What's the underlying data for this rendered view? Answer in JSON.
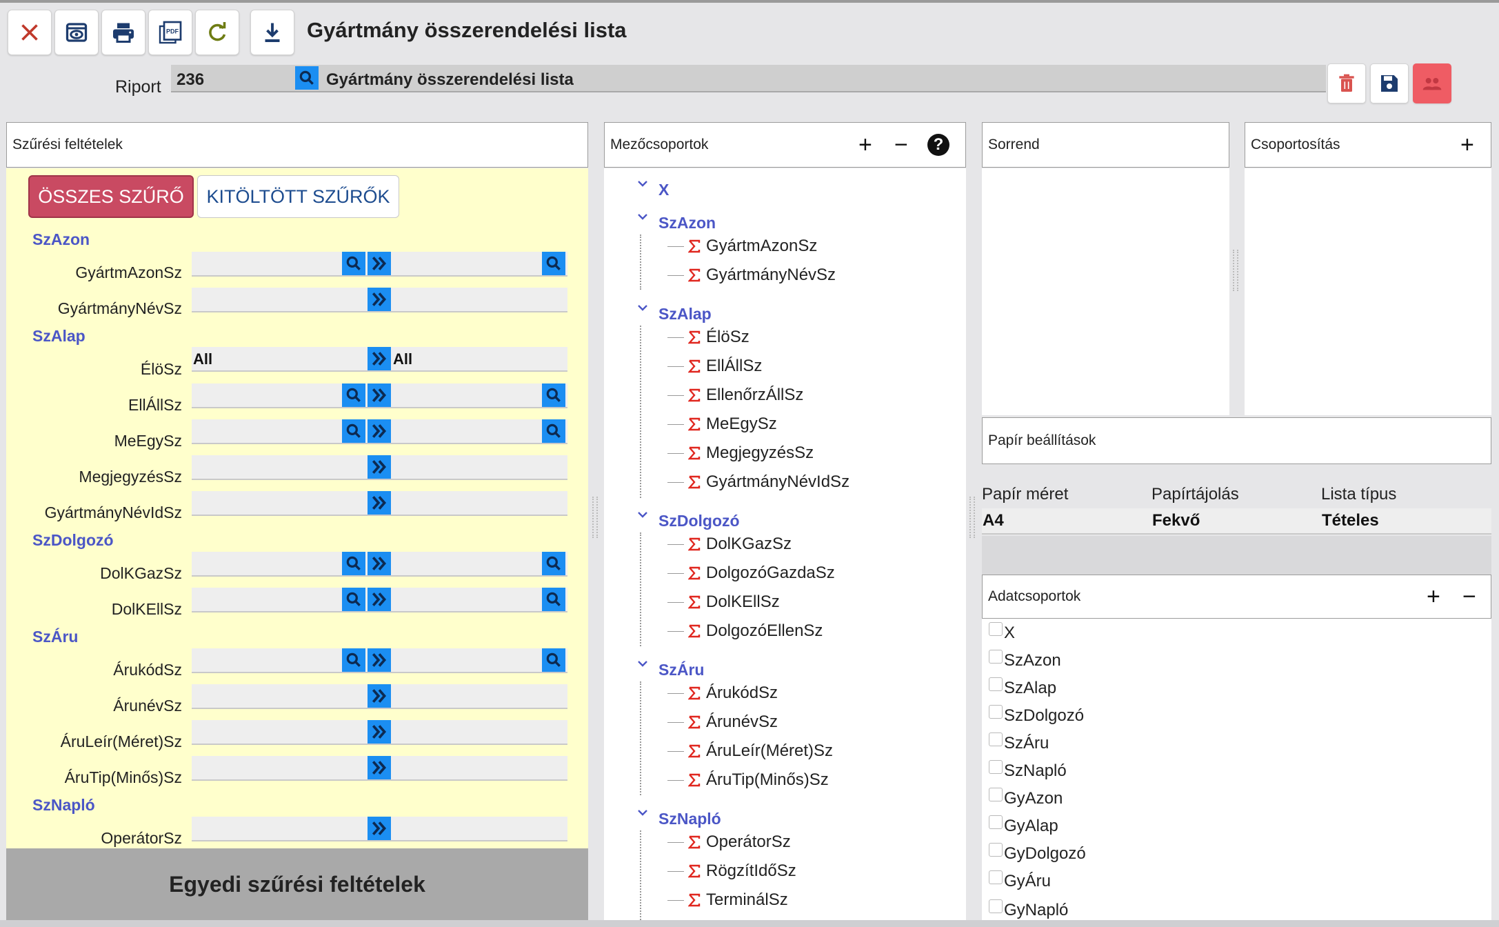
{
  "toolbar": {
    "title": "Gyártmány összerendelési lista",
    "buttons": [
      {
        "name": "close",
        "icon": "close-icon",
        "color": "#c0392b"
      },
      {
        "name": "preview",
        "icon": "eye-icon",
        "color": "#1d3c6e"
      },
      {
        "name": "print",
        "icon": "printer-icon",
        "color": "#1d3c6e"
      },
      {
        "name": "pdf",
        "icon": "pdf-icon",
        "color": "#1d3c6e",
        "label": "PDF"
      },
      {
        "name": "refresh",
        "icon": "refresh-icon",
        "color": "#6e7c13"
      },
      {
        "name": "download",
        "icon": "download-icon",
        "color": "#1d3c6e"
      }
    ]
  },
  "report": {
    "label": "Riport",
    "code": "236",
    "name": "Gyártmány összerendelési lista"
  },
  "filter_panel": {
    "title": "Szűrési feltételek",
    "all_filters_button": "ÖSSZES SZŰRŐ",
    "filled_filters_button": "KITÖLTÖTT SZŰRŐK",
    "footer": "Egyedi szűrési feltételek",
    "groups": [
      {
        "name": "SzAzon",
        "fields": [
          {
            "label": "GyártmAzonSz",
            "type": "range"
          },
          {
            "label": "GyártmányNévSz",
            "type": "text"
          }
        ]
      },
      {
        "name": "SzAlap",
        "fields": [
          {
            "label": "ÉlöSz",
            "type": "select",
            "from": "All",
            "to": "All"
          },
          {
            "label": "EllÁllSz",
            "type": "range"
          },
          {
            "label": "MeEgySz",
            "type": "range"
          },
          {
            "label": "MegjegyzésSz",
            "type": "text"
          },
          {
            "label": "GyártmányNévIdSz",
            "type": "text"
          }
        ]
      },
      {
        "name": "SzDolgozó",
        "fields": [
          {
            "label": "DolKGazSz",
            "type": "range"
          },
          {
            "label": "DolKEllSz",
            "type": "range"
          }
        ]
      },
      {
        "name": "SzÁru",
        "fields": [
          {
            "label": "ÁrukódSz",
            "type": "range"
          },
          {
            "label": "ÁrunévSz",
            "type": "text"
          },
          {
            "label": "ÁruLeír(Méret)Sz",
            "type": "text"
          },
          {
            "label": "ÁruTip(Minős)Sz",
            "type": "text"
          }
        ]
      },
      {
        "name": "SzNapló",
        "fields": [
          {
            "label": "OperátorSz",
            "type": "text"
          }
        ]
      }
    ]
  },
  "field_groups_panel": {
    "title": "Mezőcsoportok",
    "groups": [
      {
        "name": "X",
        "items": []
      },
      {
        "name": "SzAzon",
        "items": [
          "GyártmAzonSz",
          "GyártmányNévSz"
        ]
      },
      {
        "name": "SzAlap",
        "items": [
          "ÉlöSz",
          "EllÁllSz",
          "EllenőrzÁllSz",
          "MeEgySz",
          "MegjegyzésSz",
          "GyártmányNévIdSz"
        ]
      },
      {
        "name": "SzDolgozó",
        "items": [
          "DolKGazSz",
          "DolgozóGazdaSz",
          "DolKEllSz",
          "DolgozóEllenSz"
        ]
      },
      {
        "name": "SzÁru",
        "items": [
          "ÁrukódSz",
          "ÁrunévSz",
          "ÁruLeír(Méret)Sz",
          "ÁruTip(Minős)Sz"
        ]
      },
      {
        "name": "SzNapló",
        "items": [
          "OperátorSz",
          "RögzítIdőSz",
          "TerminálSz"
        ]
      }
    ]
  },
  "order_panel": {
    "title": "Sorrend"
  },
  "grouping_panel": {
    "title": "Csoportosítás"
  },
  "paper_panel": {
    "title": "Papír beállítások",
    "headers": [
      "Papír méret",
      "Papírtájolás",
      "Lista típus"
    ],
    "values": [
      "A4",
      "Fekvő",
      "Tételes"
    ]
  },
  "data_groups_panel": {
    "title": "Adatcsoportok",
    "items": [
      "X",
      "SzAzon",
      "SzAlap",
      "SzDolgozó",
      "SzÁru",
      "SzNapló",
      "GyAzon",
      "GyAlap",
      "GyDolgozó",
      "GyÁru",
      "GyNapló"
    ]
  },
  "colors": {
    "accent_blue": "#1b8ef2",
    "group_text": "#4b56c6",
    "filter_background": "#ffffcc",
    "active_button": "#c94a62",
    "delete_icon": "#d9534f",
    "users_button": "#ef5c64",
    "sigma_icon": "#e0271f"
  }
}
